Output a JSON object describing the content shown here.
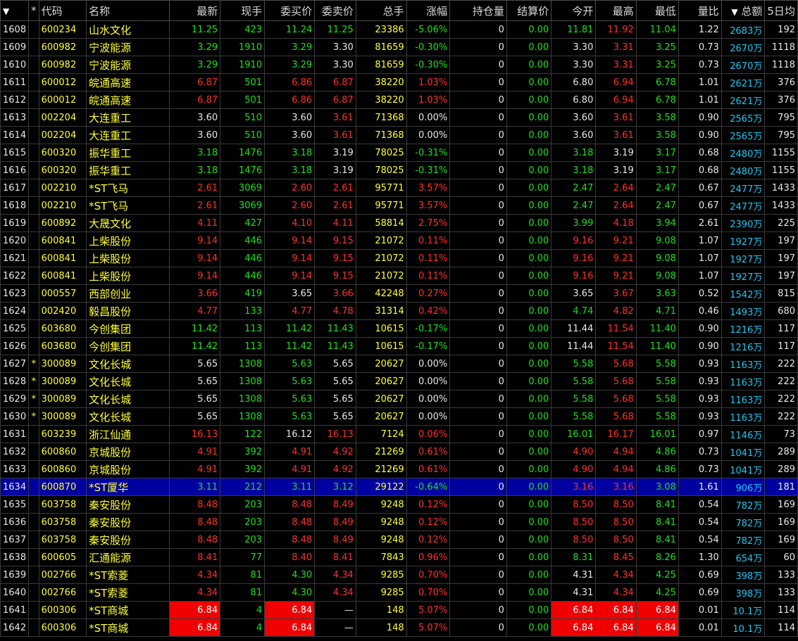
{
  "header": {
    "menu_arrow": "▼",
    "star": "*",
    "columns": [
      "代码",
      "名称",
      "最新",
      "现手",
      "委买价",
      "委卖价",
      "总手",
      "涨幅",
      "持仓量",
      "结算价",
      "今开",
      "最高",
      "最低",
      "量比"
    ],
    "sort_arrow": "▼",
    "amount": "总额",
    "avg5": "5日均"
  },
  "colors": {
    "up": "#ff3030",
    "down": "#1ee01e",
    "selected_row": "#0000a0",
    "limit_highlight": "#f00000"
  },
  "rows": [
    {
      "idx": "1608",
      "star": "",
      "code": "600234",
      "name": "山水文化",
      "last": "11.25",
      "lc": "down",
      "vol": "423",
      "bid": "11.24",
      "bc": "down",
      "ask": "11.25",
      "ac": "down",
      "total": "23386",
      "chg": "-5.06%",
      "cc": "down",
      "oi": "0",
      "settle": "0.00",
      "open": "11.81",
      "oc": "down",
      "high": "11.92",
      "hc": "up",
      "low": "11.04",
      "lwc": "down",
      "ratio": "1.22",
      "amount": "2683万",
      "avg5": "192"
    },
    {
      "idx": "1609",
      "star": "",
      "code": "600982",
      "name": "宁波能源",
      "last": "3.29",
      "lc": "down",
      "vol": "1910",
      "bid": "3.29",
      "bc": "down",
      "ask": "3.30",
      "ac": "flat",
      "total": "81659",
      "chg": "-0.30%",
      "cc": "down",
      "oi": "0",
      "settle": "0.00",
      "open": "3.30",
      "oc": "flat",
      "high": "3.31",
      "hc": "up",
      "low": "3.25",
      "lwc": "down",
      "ratio": "0.73",
      "amount": "2670万",
      "avg5": "1118"
    },
    {
      "idx": "1610",
      "star": "",
      "code": "600982",
      "name": "宁波能源",
      "last": "3.29",
      "lc": "down",
      "vol": "1910",
      "bid": "3.29",
      "bc": "down",
      "ask": "3.30",
      "ac": "flat",
      "total": "81659",
      "chg": "-0.30%",
      "cc": "down",
      "oi": "0",
      "settle": "0.00",
      "open": "3.30",
      "oc": "flat",
      "high": "3.31",
      "hc": "up",
      "low": "3.25",
      "lwc": "down",
      "ratio": "0.73",
      "amount": "2670万",
      "avg5": "1118"
    },
    {
      "idx": "1611",
      "star": "",
      "code": "600012",
      "name": "皖通高速",
      "last": "6.87",
      "lc": "up",
      "vol": "501",
      "bid": "6.86",
      "bc": "up",
      "ask": "6.87",
      "ac": "up",
      "total": "38220",
      "chg": "1.03%",
      "cc": "up",
      "oi": "0",
      "settle": "0.00",
      "open": "6.80",
      "oc": "flat",
      "high": "6.94",
      "hc": "up",
      "low": "6.78",
      "lwc": "down",
      "ratio": "1.01",
      "amount": "2621万",
      "avg5": "376"
    },
    {
      "idx": "1612",
      "star": "",
      "code": "600012",
      "name": "皖通高速",
      "last": "6.87",
      "lc": "up",
      "vol": "501",
      "bid": "6.86",
      "bc": "up",
      "ask": "6.87",
      "ac": "up",
      "total": "38220",
      "chg": "1.03%",
      "cc": "up",
      "oi": "0",
      "settle": "0.00",
      "open": "6.80",
      "oc": "flat",
      "high": "6.94",
      "hc": "up",
      "low": "6.78",
      "lwc": "down",
      "ratio": "1.01",
      "amount": "2621万",
      "avg5": "376"
    },
    {
      "idx": "1613",
      "star": "",
      "code": "002204",
      "name": "大连重工",
      "last": "3.60",
      "lc": "flat",
      "vol": "510",
      "bid": "3.60",
      "bc": "flat",
      "ask": "3.61",
      "ac": "up",
      "total": "71368",
      "chg": "0.00%",
      "cc": "flat",
      "oi": "0",
      "settle": "0.00",
      "open": "3.60",
      "oc": "flat",
      "high": "3.61",
      "hc": "up",
      "low": "3.58",
      "lwc": "down",
      "ratio": "0.90",
      "amount": "2565万",
      "avg5": "795"
    },
    {
      "idx": "1614",
      "star": "",
      "code": "002204",
      "name": "大连重工",
      "last": "3.60",
      "lc": "flat",
      "vol": "510",
      "bid": "3.60",
      "bc": "flat",
      "ask": "3.61",
      "ac": "up",
      "total": "71368",
      "chg": "0.00%",
      "cc": "flat",
      "oi": "0",
      "settle": "0.00",
      "open": "3.60",
      "oc": "flat",
      "high": "3.61",
      "hc": "up",
      "low": "3.58",
      "lwc": "down",
      "ratio": "0.90",
      "amount": "2565万",
      "avg5": "795"
    },
    {
      "idx": "1615",
      "star": "",
      "code": "600320",
      "name": "振华重工",
      "last": "3.18",
      "lc": "down",
      "vol": "1476",
      "bid": "3.18",
      "bc": "down",
      "ask": "3.19",
      "ac": "flat",
      "total": "78025",
      "chg": "-0.31%",
      "cc": "down",
      "oi": "0",
      "settle": "0.00",
      "open": "3.18",
      "oc": "down",
      "high": "3.19",
      "hc": "flat",
      "low": "3.17",
      "lwc": "down",
      "ratio": "0.68",
      "amount": "2480万",
      "avg5": "1155"
    },
    {
      "idx": "1616",
      "star": "",
      "code": "600320",
      "name": "振华重工",
      "last": "3.18",
      "lc": "down",
      "vol": "1476",
      "bid": "3.18",
      "bc": "down",
      "ask": "3.19",
      "ac": "flat",
      "total": "78025",
      "chg": "-0.31%",
      "cc": "down",
      "oi": "0",
      "settle": "0.00",
      "open": "3.18",
      "oc": "down",
      "high": "3.19",
      "hc": "flat",
      "low": "3.17",
      "lwc": "down",
      "ratio": "0.68",
      "amount": "2480万",
      "avg5": "1155"
    },
    {
      "idx": "1617",
      "star": "",
      "code": "002210",
      "name": "*ST飞马",
      "last": "2.61",
      "lc": "up",
      "vol": "3069",
      "bid": "2.60",
      "bc": "up",
      "ask": "2.61",
      "ac": "up",
      "total": "95771",
      "chg": "3.57%",
      "cc": "up",
      "oi": "0",
      "settle": "0.00",
      "open": "2.47",
      "oc": "down",
      "high": "2.64",
      "hc": "up",
      "low": "2.47",
      "lwc": "down",
      "ratio": "0.67",
      "amount": "2477万",
      "avg5": "1433"
    },
    {
      "idx": "1618",
      "star": "",
      "code": "002210",
      "name": "*ST飞马",
      "last": "2.61",
      "lc": "up",
      "vol": "3069",
      "bid": "2.60",
      "bc": "up",
      "ask": "2.61",
      "ac": "up",
      "total": "95771",
      "chg": "3.57%",
      "cc": "up",
      "oi": "0",
      "settle": "0.00",
      "open": "2.47",
      "oc": "down",
      "high": "2.64",
      "hc": "up",
      "low": "2.47",
      "lwc": "down",
      "ratio": "0.67",
      "amount": "2477万",
      "avg5": "1433"
    },
    {
      "idx": "1619",
      "star": "",
      "code": "600892",
      "name": "大晟文化",
      "last": "4.11",
      "lc": "up",
      "vol": "427",
      "bid": "4.10",
      "bc": "up",
      "ask": "4.11",
      "ac": "up",
      "total": "58814",
      "chg": "2.75%",
      "cc": "up",
      "oi": "0",
      "settle": "0.00",
      "open": "3.99",
      "oc": "down",
      "high": "4.18",
      "hc": "up",
      "low": "3.94",
      "lwc": "down",
      "ratio": "2.61",
      "amount": "2390万",
      "avg5": "225"
    },
    {
      "idx": "1620",
      "star": "",
      "code": "600841",
      "name": "上柴股份",
      "last": "9.14",
      "lc": "up",
      "vol": "446",
      "bid": "9.14",
      "bc": "up",
      "ask": "9.15",
      "ac": "up",
      "total": "21072",
      "chg": "0.11%",
      "cc": "up",
      "oi": "0",
      "settle": "0.00",
      "open": "9.16",
      "oc": "up",
      "high": "9.21",
      "hc": "up",
      "low": "9.08",
      "lwc": "down",
      "ratio": "1.07",
      "amount": "1927万",
      "avg5": "197"
    },
    {
      "idx": "1621",
      "star": "",
      "code": "600841",
      "name": "上柴股份",
      "last": "9.14",
      "lc": "up",
      "vol": "446",
      "bid": "9.14",
      "bc": "up",
      "ask": "9.15",
      "ac": "up",
      "total": "21072",
      "chg": "0.11%",
      "cc": "up",
      "oi": "0",
      "settle": "0.00",
      "open": "9.16",
      "oc": "up",
      "high": "9.21",
      "hc": "up",
      "low": "9.08",
      "lwc": "down",
      "ratio": "1.07",
      "amount": "1927万",
      "avg5": "197"
    },
    {
      "idx": "1622",
      "star": "",
      "code": "600841",
      "name": "上柴股份",
      "last": "9.14",
      "lc": "up",
      "vol": "446",
      "bid": "9.14",
      "bc": "up",
      "ask": "9.15",
      "ac": "up",
      "total": "21072",
      "chg": "0.11%",
      "cc": "up",
      "oi": "0",
      "settle": "0.00",
      "open": "9.16",
      "oc": "up",
      "high": "9.21",
      "hc": "up",
      "low": "9.08",
      "lwc": "down",
      "ratio": "1.07",
      "amount": "1927万",
      "avg5": "197"
    },
    {
      "idx": "1623",
      "star": "",
      "code": "000557",
      "name": "西部创业",
      "last": "3.66",
      "lc": "up",
      "vol": "419",
      "bid": "3.65",
      "bc": "flat",
      "ask": "3.66",
      "ac": "up",
      "total": "42248",
      "chg": "0.27%",
      "cc": "up",
      "oi": "0",
      "settle": "0.00",
      "open": "3.65",
      "oc": "flat",
      "high": "3.67",
      "hc": "up",
      "low": "3.63",
      "lwc": "down",
      "ratio": "0.52",
      "amount": "1542万",
      "avg5": "815"
    },
    {
      "idx": "1624",
      "star": "",
      "code": "002420",
      "name": "毅昌股份",
      "last": "4.77",
      "lc": "up",
      "vol": "133",
      "bid": "4.77",
      "bc": "up",
      "ask": "4.78",
      "ac": "up",
      "total": "31314",
      "chg": "0.42%",
      "cc": "up",
      "oi": "0",
      "settle": "0.00",
      "open": "4.74",
      "oc": "down",
      "high": "4.82",
      "hc": "up",
      "low": "4.71",
      "lwc": "down",
      "ratio": "0.46",
      "amount": "1493万",
      "avg5": "680"
    },
    {
      "idx": "1625",
      "star": "",
      "code": "603680",
      "name": "今创集团",
      "last": "11.42",
      "lc": "down",
      "vol": "113",
      "bid": "11.42",
      "bc": "down",
      "ask": "11.43",
      "ac": "down",
      "total": "10615",
      "chg": "-0.17%",
      "cc": "down",
      "oi": "0",
      "settle": "0.00",
      "open": "11.44",
      "oc": "flat",
      "high": "11.54",
      "hc": "up",
      "low": "11.40",
      "lwc": "down",
      "ratio": "0.90",
      "amount": "1216万",
      "avg5": "117"
    },
    {
      "idx": "1626",
      "star": "",
      "code": "603680",
      "name": "今创集团",
      "last": "11.42",
      "lc": "down",
      "vol": "113",
      "bid": "11.42",
      "bc": "down",
      "ask": "11.43",
      "ac": "down",
      "total": "10615",
      "chg": "-0.17%",
      "cc": "down",
      "oi": "0",
      "settle": "0.00",
      "open": "11.44",
      "oc": "flat",
      "high": "11.54",
      "hc": "up",
      "low": "11.40",
      "lwc": "down",
      "ratio": "0.90",
      "amount": "1216万",
      "avg5": "117"
    },
    {
      "idx": "1627",
      "star": "*",
      "code": "300089",
      "name": "文化长城",
      "last": "5.65",
      "lc": "flat",
      "vol": "1308",
      "bid": "5.63",
      "bc": "down",
      "ask": "5.65",
      "ac": "flat",
      "total": "20627",
      "chg": "0.00%",
      "cc": "flat",
      "oi": "0",
      "settle": "0.00",
      "open": "5.58",
      "oc": "down",
      "high": "5.68",
      "hc": "up",
      "low": "5.58",
      "lwc": "down",
      "ratio": "0.93",
      "amount": "1163万",
      "avg5": "222"
    },
    {
      "idx": "1628",
      "star": "*",
      "code": "300089",
      "name": "文化长城",
      "last": "5.65",
      "lc": "flat",
      "vol": "1308",
      "bid": "5.63",
      "bc": "down",
      "ask": "5.65",
      "ac": "flat",
      "total": "20627",
      "chg": "0.00%",
      "cc": "flat",
      "oi": "0",
      "settle": "0.00",
      "open": "5.58",
      "oc": "down",
      "high": "5.68",
      "hc": "up",
      "low": "5.58",
      "lwc": "down",
      "ratio": "0.93",
      "amount": "1163万",
      "avg5": "222"
    },
    {
      "idx": "1629",
      "star": "*",
      "code": "300089",
      "name": "文化长城",
      "last": "5.65",
      "lc": "flat",
      "vol": "1308",
      "bid": "5.63",
      "bc": "down",
      "ask": "5.65",
      "ac": "flat",
      "total": "20627",
      "chg": "0.00%",
      "cc": "flat",
      "oi": "0",
      "settle": "0.00",
      "open": "5.58",
      "oc": "down",
      "high": "5.68",
      "hc": "up",
      "low": "5.58",
      "lwc": "down",
      "ratio": "0.93",
      "amount": "1163万",
      "avg5": "222"
    },
    {
      "idx": "1630",
      "star": "*",
      "code": "300089",
      "name": "文化长城",
      "last": "5.65",
      "lc": "flat",
      "vol": "1308",
      "bid": "5.63",
      "bc": "down",
      "ask": "5.65",
      "ac": "flat",
      "total": "20627",
      "chg": "0.00%",
      "cc": "flat",
      "oi": "0",
      "settle": "0.00",
      "open": "5.58",
      "oc": "down",
      "high": "5.68",
      "hc": "up",
      "low": "5.58",
      "lwc": "down",
      "ratio": "0.93",
      "amount": "1163万",
      "avg5": "222"
    },
    {
      "idx": "1631",
      "star": "",
      "code": "603239",
      "name": "浙江仙通",
      "last": "16.13",
      "lc": "up",
      "vol": "122",
      "bid": "16.12",
      "bc": "flat",
      "ask": "16.13",
      "ac": "up",
      "total": "7124",
      "chg": "0.06%",
      "cc": "up",
      "oi": "0",
      "settle": "0.00",
      "open": "16.01",
      "oc": "down",
      "high": "16.17",
      "hc": "up",
      "low": "16.01",
      "lwc": "down",
      "ratio": "0.97",
      "amount": "1146万",
      "avg5": "73"
    },
    {
      "idx": "1632",
      "star": "",
      "code": "600860",
      "name": "京城股份",
      "last": "4.91",
      "lc": "up",
      "vol": "392",
      "bid": "4.91",
      "bc": "up",
      "ask": "4.92",
      "ac": "up",
      "total": "21269",
      "chg": "0.61%",
      "cc": "up",
      "oi": "0",
      "settle": "0.00",
      "open": "4.90",
      "oc": "up",
      "high": "4.94",
      "hc": "up",
      "low": "4.86",
      "lwc": "down",
      "ratio": "0.73",
      "amount": "1041万",
      "avg5": "289"
    },
    {
      "idx": "1633",
      "star": "",
      "code": "600860",
      "name": "京城股份",
      "last": "4.91",
      "lc": "up",
      "vol": "392",
      "bid": "4.91",
      "bc": "up",
      "ask": "4.92",
      "ac": "up",
      "total": "21269",
      "chg": "0.61%",
      "cc": "up",
      "oi": "0",
      "settle": "0.00",
      "open": "4.90",
      "oc": "up",
      "high": "4.94",
      "hc": "up",
      "low": "4.86",
      "lwc": "down",
      "ratio": "0.73",
      "amount": "1041万",
      "avg5": "289"
    },
    {
      "idx": "1634",
      "star": "",
      "code": "600870",
      "name": "*ST厦华",
      "last": "3.11",
      "lc": "down",
      "vol": "212",
      "bid": "3.11",
      "bc": "down",
      "ask": "3.12",
      "ac": "down",
      "total": "29122",
      "chg": "-0.64%",
      "cc": "down",
      "oi": "0",
      "settle": "0.00",
      "open": "3.16",
      "oc": "up",
      "high": "3.16",
      "hc": "up",
      "low": "3.08",
      "lwc": "down",
      "ratio": "1.61",
      "amount": "906万",
      "avg5": "181",
      "selected": true
    },
    {
      "idx": "1635",
      "star": "",
      "code": "603758",
      "name": "秦安股份",
      "last": "8.48",
      "lc": "up",
      "vol": "203",
      "bid": "8.48",
      "bc": "up",
      "ask": "8.49",
      "ac": "up",
      "total": "9248",
      "chg": "0.12%",
      "cc": "up",
      "oi": "0",
      "settle": "0.00",
      "open": "8.50",
      "oc": "up",
      "high": "8.50",
      "hc": "up",
      "low": "8.41",
      "lwc": "down",
      "ratio": "0.54",
      "amount": "782万",
      "avg5": "169"
    },
    {
      "idx": "1636",
      "star": "",
      "code": "603758",
      "name": "秦安股份",
      "last": "8.48",
      "lc": "up",
      "vol": "203",
      "bid": "8.48",
      "bc": "up",
      "ask": "8.49",
      "ac": "up",
      "total": "9248",
      "chg": "0.12%",
      "cc": "up",
      "oi": "0",
      "settle": "0.00",
      "open": "8.50",
      "oc": "up",
      "high": "8.50",
      "hc": "up",
      "low": "8.41",
      "lwc": "down",
      "ratio": "0.54",
      "amount": "782万",
      "avg5": "169"
    },
    {
      "idx": "1637",
      "star": "",
      "code": "603758",
      "name": "秦安股份",
      "last": "8.48",
      "lc": "up",
      "vol": "203",
      "bid": "8.48",
      "bc": "up",
      "ask": "8.49",
      "ac": "up",
      "total": "9248",
      "chg": "0.12%",
      "cc": "up",
      "oi": "0",
      "settle": "0.00",
      "open": "8.50",
      "oc": "up",
      "high": "8.50",
      "hc": "up",
      "low": "8.41",
      "lwc": "down",
      "ratio": "0.54",
      "amount": "782万",
      "avg5": "169"
    },
    {
      "idx": "1638",
      "star": "",
      "code": "600605",
      "name": "汇通能源",
      "last": "8.41",
      "lc": "up",
      "vol": "77",
      "bid": "8.40",
      "bc": "up",
      "ask": "8.41",
      "ac": "up",
      "total": "7843",
      "chg": "0.96%",
      "cc": "up",
      "oi": "0",
      "settle": "0.00",
      "open": "8.31",
      "oc": "down",
      "high": "8.45",
      "hc": "up",
      "low": "8.26",
      "lwc": "down",
      "ratio": "1.30",
      "amount": "654万",
      "avg5": "60"
    },
    {
      "idx": "1639",
      "star": "",
      "code": "002766",
      "name": "*ST索菱",
      "last": "4.34",
      "lc": "up",
      "vol": "81",
      "bid": "4.30",
      "bc": "down",
      "ask": "4.34",
      "ac": "up",
      "total": "9285",
      "chg": "0.70%",
      "cc": "up",
      "oi": "0",
      "settle": "0.00",
      "open": "4.31",
      "oc": "flat",
      "high": "4.34",
      "hc": "up",
      "low": "4.25",
      "lwc": "down",
      "ratio": "0.69",
      "amount": "398万",
      "avg5": "133"
    },
    {
      "idx": "1640",
      "star": "",
      "code": "002766",
      "name": "*ST索菱",
      "last": "4.34",
      "lc": "up",
      "vol": "81",
      "bid": "4.30",
      "bc": "down",
      "ask": "4.34",
      "ac": "up",
      "total": "9285",
      "chg": "0.70%",
      "cc": "up",
      "oi": "0",
      "settle": "0.00",
      "open": "4.31",
      "oc": "flat",
      "high": "4.34",
      "hc": "up",
      "low": "4.25",
      "lwc": "down",
      "ratio": "0.69",
      "amount": "398万",
      "avg5": "133"
    },
    {
      "idx": "1641",
      "star": "",
      "code": "600306",
      "name": "*ST商城",
      "last": "6.84",
      "lc": "limit",
      "vol": "4",
      "bid": "6.84",
      "bc": "limit",
      "ask": "—",
      "ac": "flat",
      "total": "148",
      "chg": "5.07%",
      "cc": "up",
      "oi": "0",
      "settle": "0.00",
      "open": "6.84",
      "oc": "limit",
      "high": "6.84",
      "hc": "limit",
      "low": "6.84",
      "lwc": "limit",
      "ratio": "0.01",
      "amount": "10.1万",
      "avg5": "114"
    },
    {
      "idx": "1642",
      "star": "",
      "code": "600306",
      "name": "*ST商城",
      "last": "6.84",
      "lc": "limit",
      "vol": "4",
      "bid": "6.84",
      "bc": "limit",
      "ask": "—",
      "ac": "flat",
      "total": "148",
      "chg": "5.07%",
      "cc": "up",
      "oi": "0",
      "settle": "0.00",
      "open": "6.84",
      "oc": "limit",
      "high": "6.84",
      "hc": "limit",
      "low": "6.84",
      "lwc": "limit",
      "ratio": "0.01",
      "amount": "10.1万",
      "avg5": "114"
    }
  ]
}
